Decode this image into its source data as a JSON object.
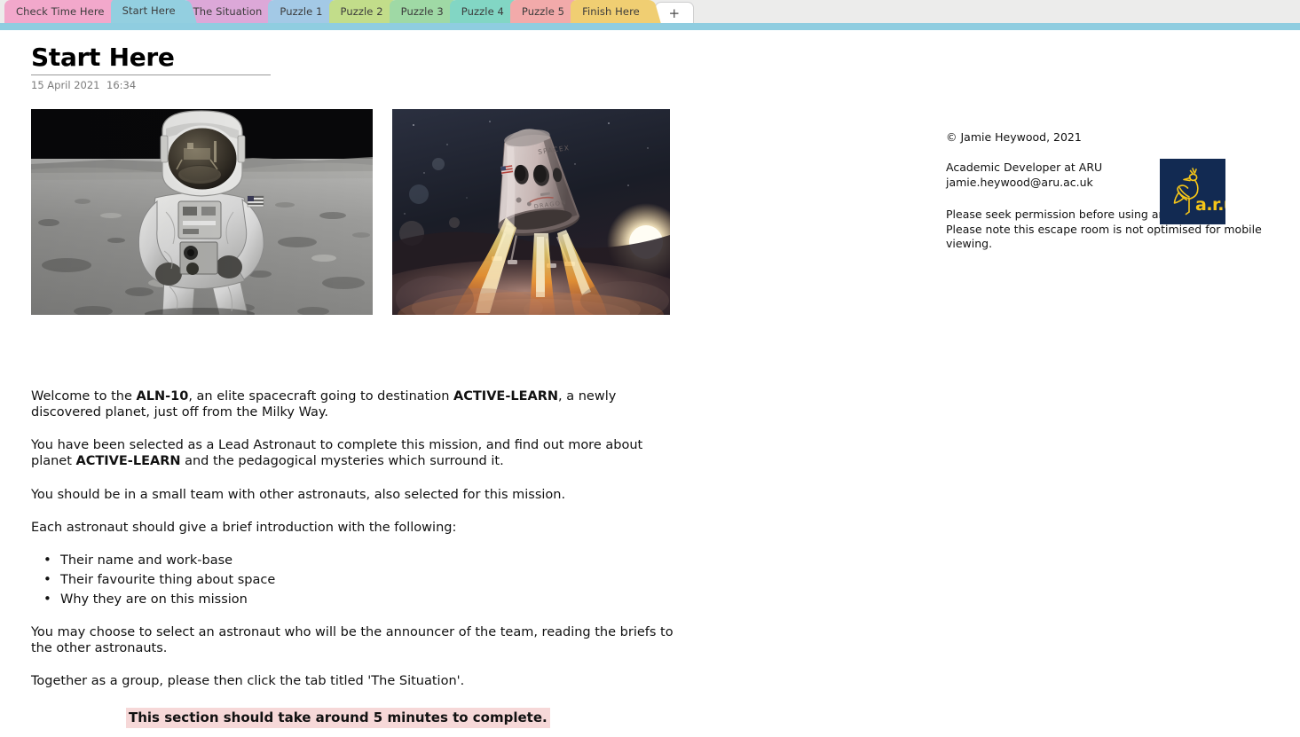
{
  "tabs": {
    "items": [
      {
        "label": "Check Time Here",
        "color": "#f2a8cb",
        "active": false
      },
      {
        "label": "Start Here",
        "color": "#93cfe0",
        "active": true
      },
      {
        "label": "The Situation",
        "color": "#dca8d8",
        "active": false
      },
      {
        "label": "Puzzle 1",
        "color": "#a3c9e6",
        "active": false
      },
      {
        "label": "Puzzle 2",
        "color": "#c2dd8a",
        "active": false
      },
      {
        "label": "Puzzle 3",
        "color": "#9fd9a5",
        "active": false
      },
      {
        "label": "Puzzle 4",
        "color": "#82d6c4",
        "active": false
      },
      {
        "label": "Puzzle 5",
        "color": "#f2aaaa",
        "active": false
      },
      {
        "label": "Finish Here",
        "color": "#f0ce72",
        "active": false
      }
    ],
    "add_tab_label": "+",
    "strip_color": "#8fcde0",
    "bar_background": "#ececeb"
  },
  "header": {
    "title": "Start Here",
    "date": "15 April 2021",
    "time": "16:34"
  },
  "images": {
    "astronaut": {
      "name": "astronaut-on-the-moon-photo",
      "alt": "Black and white photograph of an astronaut standing on the lunar surface"
    },
    "rocket": {
      "name": "spacex-dragon-capsule-photo",
      "alt": "SpaceX Dragon capsule firing thrusters while landing",
      "capsule_text": "SPACEX",
      "capsule_subtext": "DRAGON"
    }
  },
  "info": {
    "copyright": "© Jamie Heywood, 2021",
    "role": "Academic Developer at ARU",
    "email": "jamie.heywood@aru.ac.uk",
    "note_line1": "Please seek permission before using and sharing.",
    "note_line2": "Please note this escape room is not optimised for mobile",
    "note_line3": "viewing.",
    "logo": {
      "name": "aru-logo",
      "text": "a.r.u.",
      "background": "#122a52",
      "foreground": "#f5c518"
    }
  },
  "content": {
    "p1_a": "Welcome to the ",
    "p1_b1": "ALN-10",
    "p1_b": ", an elite spacecraft going to destination ",
    "p1_b2": "ACTIVE-LEARN",
    "p1_c": ", a newly discovered planet, just off from the Milky Way.",
    "p2_a": "You have been selected as a Lead Astronaut to complete this mission, and find out more about planet ",
    "p2_b1": "ACTIVE-LEARN",
    "p2_c": " and the pedagogical mysteries which surround it.",
    "p3": "You should be in a small team with other astronauts, also selected for this mission.",
    "p4": "Each astronaut should give a brief introduction with the following:",
    "bullets": [
      "Their name and work-base",
      "Their favourite thing about space",
      "Why they are on this mission"
    ],
    "p5": "You may choose to select an astronaut who will be the announcer of the team, reading the briefs to the other astronauts.",
    "p6": "Together as a group, please then click the tab titled 'The Situation'.",
    "footnote": "This section should take around 5 minutes to complete.",
    "footnote_highlight": "#f6d8d8"
  }
}
